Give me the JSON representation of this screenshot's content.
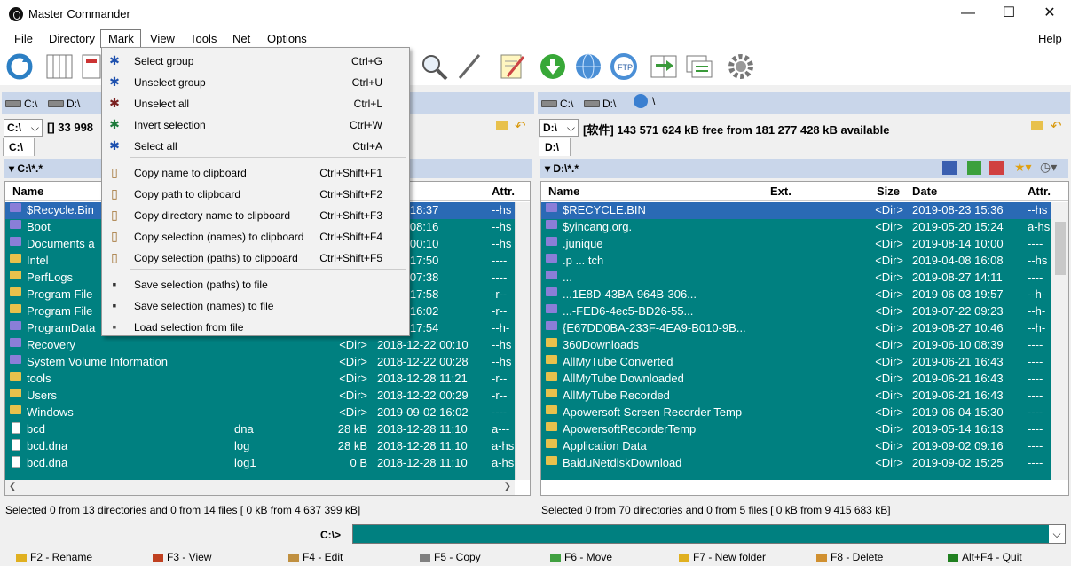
{
  "window": {
    "title": "Master Commander",
    "minimize": "—",
    "maximize": "☐",
    "close": "✕"
  },
  "menu": {
    "file": "File",
    "directory": "Directory",
    "mark": "Mark",
    "view": "View",
    "tools": "Tools",
    "net": "Net",
    "options": "Options",
    "help": "Help"
  },
  "mark_menu": [
    {
      "label": "Select group",
      "shortcut": "Ctrl+G",
      "icon": "select-plus-icon"
    },
    {
      "label": "Unselect group",
      "shortcut": "Ctrl+U",
      "icon": "select-minus-icon"
    },
    {
      "label": "Unselect all",
      "shortcut": "Ctrl+L",
      "icon": "unselect-all-icon"
    },
    {
      "label": "Invert selection",
      "shortcut": "Ctrl+W",
      "icon": "invert-icon"
    },
    {
      "label": "Select all",
      "shortcut": "Ctrl+A",
      "icon": "select-all-icon"
    },
    {
      "label": "Copy name to clipboard",
      "shortcut": "Ctrl+Shift+F1",
      "icon": "clipboard-icon"
    },
    {
      "label": "Copy path to clipboard",
      "shortcut": "Ctrl+Shift+F2",
      "icon": "clipboard-icon"
    },
    {
      "label": "Copy directory name to clipboard",
      "shortcut": "Ctrl+Shift+F3",
      "icon": "clipboard-icon"
    },
    {
      "label": "Copy selection (names) to clipboard",
      "shortcut": "Ctrl+Shift+F4",
      "icon": "clipboard-list-icon"
    },
    {
      "label": "Copy selection (paths) to clipboard",
      "shortcut": "Ctrl+Shift+F5",
      "icon": "clipboard-list-icon"
    },
    {
      "label": "Save selection (paths) to file",
      "shortcut": "",
      "icon": "save-icon"
    },
    {
      "label": "Save selection (names) to file",
      "shortcut": "",
      "icon": "save-icon"
    },
    {
      "label": "Load selection from file",
      "shortcut": "",
      "icon": "load-icon"
    }
  ],
  "left": {
    "drives": [
      "C:\\",
      "D:\\"
    ],
    "drive_select": "C:\\",
    "free": "[] 33 998",
    "tab": "C:\\",
    "filter": "▾ C:\\*.*",
    "cols": {
      "name": "Name",
      "attr": "Attr."
    },
    "rows": [
      {
        "name": "$Recycle.Bin",
        "ext": "",
        "size": "",
        "date": "01-07 18:37",
        "attr": "--hs"
      },
      {
        "name": "Boot",
        "ext": "",
        "size": "",
        "date": "09-03 08:16",
        "attr": "--hs"
      },
      {
        "name": "Documents a",
        "ext": "",
        "size": "",
        "date": "12-22 00:10",
        "attr": "--hs"
      },
      {
        "name": "Intel",
        "ext": "",
        "size": "",
        "date": "12-22 17:50",
        "attr": "----"
      },
      {
        "name": "PerfLogs",
        "ext": "",
        "size": "",
        "date": "04-12 07:38",
        "attr": "----"
      },
      {
        "name": "Program File",
        "ext": "",
        "size": "",
        "date": "09-02 17:58",
        "attr": "-r--"
      },
      {
        "name": "Program File",
        "ext": "",
        "size": "",
        "date": "09-02 16:02",
        "attr": "-r--"
      },
      {
        "name": "ProgramData",
        "ext": "",
        "size": "",
        "date": "09-02 17:54",
        "attr": "--h-"
      },
      {
        "name": "Recovery",
        "ext": "",
        "size": "<Dir>",
        "date": "2018-12-22 00:10",
        "attr": "--hs"
      },
      {
        "name": "System Volume Information",
        "ext": "",
        "size": "<Dir>",
        "date": "2018-12-22 00:28",
        "attr": "--hs"
      },
      {
        "name": "tools",
        "ext": "",
        "size": "<Dir>",
        "date": "2018-12-28 11:21",
        "attr": "-r--"
      },
      {
        "name": "Users",
        "ext": "",
        "size": "<Dir>",
        "date": "2018-12-22 00:29",
        "attr": "-r--"
      },
      {
        "name": "Windows",
        "ext": "",
        "size": "<Dir>",
        "date": "2019-09-02 16:02",
        "attr": "----"
      },
      {
        "name": "bcd",
        "ext": "dna",
        "size": "28 kB",
        "date": "2018-12-28 11:10",
        "attr": "a---"
      },
      {
        "name": "bcd.dna",
        "ext": "log",
        "size": "28 kB",
        "date": "2018-12-28 11:10",
        "attr": "a-hs"
      },
      {
        "name": "bcd.dna",
        "ext": "log1",
        "size": "0 B",
        "date": "2018-12-28 11:10",
        "attr": "a-hs"
      }
    ],
    "status": "Selected 0 from 13 directories and 0 from 14 files [ 0 kB from 4 637 399 kB]"
  },
  "right": {
    "drives": [
      "C:\\",
      "D:\\",
      "\\"
    ],
    "drive_select": "D:\\",
    "free": "[软件] 143 571 624 kB free from 181 277 428 kB available",
    "tab": "D:\\",
    "filter": "▾ D:\\*.*",
    "cols": {
      "name": "Name",
      "ext": "Ext.",
      "size": "Size",
      "date": "Date",
      "attr": "Attr."
    },
    "rows": [
      {
        "name": "$RECYCLE.BIN",
        "size": "<Dir>",
        "date": "2019-08-23 15:36",
        "attr": "--hs"
      },
      {
        "name": "$yincang.org.",
        "size": "<Dir>",
        "date": "2019-05-20 15:24",
        "attr": "a-hs"
      },
      {
        "name": ".junique",
        "size": "<Dir>",
        "date": "2019-08-14 10:00",
        "attr": "----"
      },
      {
        "name": ".p  ...  tch",
        "size": "<Dir>",
        "date": "2019-04-08 16:08",
        "attr": "--hs"
      },
      {
        "name": "...",
        "size": "<Dir>",
        "date": "2019-08-27 14:11",
        "attr": "----"
      },
      {
        "name": "...1E8D-43BA-964B-306...",
        "size": "<Dir>",
        "date": "2019-06-03 19:57",
        "attr": "--h-"
      },
      {
        "name": "...-FED6-4ec5-BD26-55...",
        "size": "<Dir>",
        "date": "2019-07-22 09:23",
        "attr": "--h-"
      },
      {
        "name": "{E67DD0BA-233F-4EA9-B010-9B...",
        "size": "<Dir>",
        "date": "2019-08-27 10:46",
        "attr": "--h-"
      },
      {
        "name": "360Downloads",
        "size": "<Dir>",
        "date": "2019-06-10 08:39",
        "attr": "----"
      },
      {
        "name": "AllMyTube Converted",
        "size": "<Dir>",
        "date": "2019-06-21 16:43",
        "attr": "----"
      },
      {
        "name": "AllMyTube Downloaded",
        "size": "<Dir>",
        "date": "2019-06-21 16:43",
        "attr": "----"
      },
      {
        "name": "AllMyTube Recorded",
        "size": "<Dir>",
        "date": "2019-06-21 16:43",
        "attr": "----"
      },
      {
        "name": "Apowersoft Screen Recorder Temp",
        "size": "<Dir>",
        "date": "2019-06-04 15:30",
        "attr": "----"
      },
      {
        "name": "ApowersoftRecorderTemp",
        "size": "<Dir>",
        "date": "2019-05-14 16:13",
        "attr": "----"
      },
      {
        "name": "Application Data",
        "size": "<Dir>",
        "date": "2019-09-02 09:16",
        "attr": "----"
      },
      {
        "name": "BaiduNetdiskDownload",
        "size": "<Dir>",
        "date": "2019-09-02 15:25",
        "attr": "----"
      }
    ],
    "status": "Selected 0 from 70 directories and 0 from 5 files [ 0 kB from 9 415 683 kB]"
  },
  "cmd": {
    "prompt": "C:\\>",
    "value": ""
  },
  "fkeys": [
    {
      "label": "F2 - Rename",
      "color": "#e0b020"
    },
    {
      "label": "F3 - View",
      "color": "#c04020"
    },
    {
      "label": "F4 - Edit",
      "color": "#c09040"
    },
    {
      "label": "F5 - Copy",
      "color": "#808080"
    },
    {
      "label": "F6 - Move",
      "color": "#40a040"
    },
    {
      "label": "F7 - New folder",
      "color": "#e0b020"
    },
    {
      "label": "F8 - Delete",
      "color": "#d09030"
    },
    {
      "label": "Alt+F4 - Quit",
      "color": "#208020"
    }
  ]
}
